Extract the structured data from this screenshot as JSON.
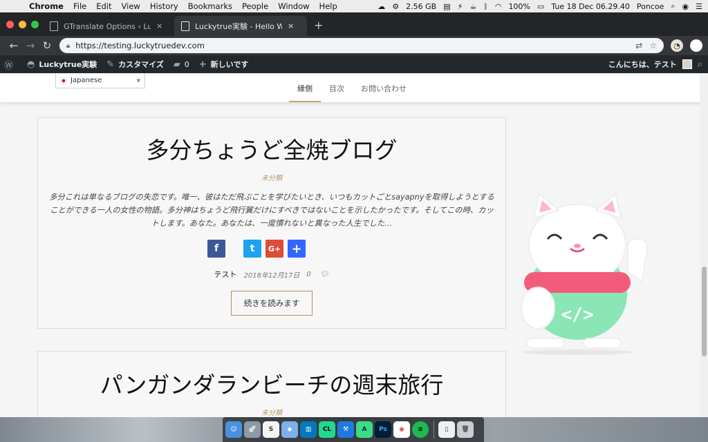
{
  "menubar": {
    "apple": "",
    "items": [
      "Chrome",
      "File",
      "Edit",
      "View",
      "History",
      "Bookmarks",
      "People",
      "Window",
      "Help"
    ],
    "memory": "2.56 GB",
    "battery": "100%",
    "clock": "Tue 18 Dec  06.29.40",
    "user": "Poncoe"
  },
  "tabs": [
    {
      "title": "GTranslate Options ‹ Luckytrue実験",
      "close": "×"
    },
    {
      "title": "Luckytrue実験 - Hello Worldの実験",
      "close": "×"
    }
  ],
  "newtab": "+",
  "toolbar": {
    "back": "←",
    "forward": "→",
    "reload": "↻",
    "url": "https://testing.luckytruedev.com"
  },
  "adminbar": {
    "site_name": "Luckytrue実験",
    "customize": "カスタマイズ",
    "comments": "0",
    "new": "新しいです",
    "greeting": "こんにちは、テスト"
  },
  "site": {
    "language": "Japanese",
    "nav": [
      "縁側",
      "目次",
      "お問い合わせ"
    ]
  },
  "posts": [
    {
      "title": "多分ちょうど全焼ブログ",
      "category": "未分類",
      "excerpt": "多分これは単なるブログの失恋です。唯一、彼はただ飛ぶことを学びたいとき、いつもカットごとsayapnyを取得しようとすることができる一人の女性の物語。多分神はちょうど飛行翼だけにすべきではないことを示したかったです。そしてこの時、カットします。あなた。あなたは、一度慣れないと異なった人生でした…",
      "share": [
        "f",
        "t",
        "G+",
        "+"
      ],
      "author": "テスト",
      "date": "2018年12月17日",
      "comment_count": "0",
      "read_more": "続きを読みます"
    },
    {
      "title": "パンガンダランビーチの週末旅行",
      "category": "未分類"
    }
  ],
  "colors": {
    "accent": "#c0a57a",
    "readmore_border": "#b38f5e",
    "facebook": "#3b5998",
    "twitter": "#1da1f2",
    "google": "#dd4b39",
    "addthis": "#3366ff",
    "mascot_collar": "#f35b7a",
    "mascot_body": "#8ae6b4"
  },
  "dock": [
    "Finder",
    "Launchpad",
    "Scrivener",
    "Cube",
    "Trello",
    "CLion",
    "Xcode",
    "Android Studio",
    "Photoshop",
    "Chrome",
    "Spotify",
    "Documents",
    "Trash"
  ]
}
